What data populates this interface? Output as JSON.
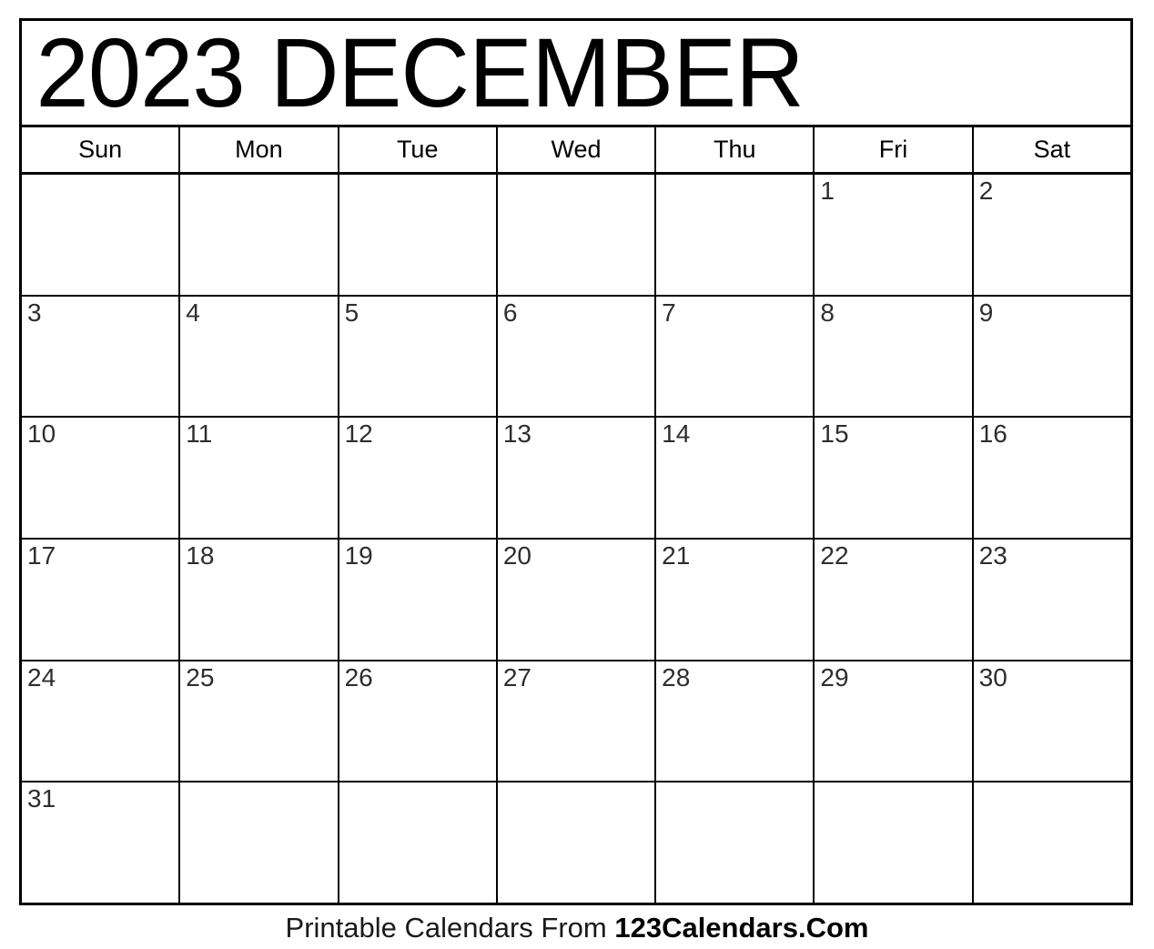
{
  "calendar": {
    "title": "2023 DECEMBER",
    "year": "2023",
    "month": "DECEMBER",
    "weekdays": [
      {
        "short": "Sun"
      },
      {
        "short": "Mon"
      },
      {
        "short": "Tue"
      },
      {
        "short": "Wed"
      },
      {
        "short": "Thu"
      },
      {
        "short": "Fri"
      },
      {
        "short": "Sat"
      }
    ],
    "weeks": [
      [
        {
          "day": ""
        },
        {
          "day": ""
        },
        {
          "day": ""
        },
        {
          "day": ""
        },
        {
          "day": ""
        },
        {
          "day": "1"
        },
        {
          "day": "2"
        }
      ],
      [
        {
          "day": "3"
        },
        {
          "day": "4"
        },
        {
          "day": "5"
        },
        {
          "day": "6"
        },
        {
          "day": "7"
        },
        {
          "day": "8"
        },
        {
          "day": "9"
        }
      ],
      [
        {
          "day": "10"
        },
        {
          "day": "11"
        },
        {
          "day": "12"
        },
        {
          "day": "13"
        },
        {
          "day": "14"
        },
        {
          "day": "15"
        },
        {
          "day": "16"
        }
      ],
      [
        {
          "day": "17"
        },
        {
          "day": "18"
        },
        {
          "day": "19"
        },
        {
          "day": "20"
        },
        {
          "day": "21"
        },
        {
          "day": "22"
        },
        {
          "day": "23"
        }
      ],
      [
        {
          "day": "24"
        },
        {
          "day": "25"
        },
        {
          "day": "26"
        },
        {
          "day": "27"
        },
        {
          "day": "28"
        },
        {
          "day": "29"
        },
        {
          "day": "30"
        }
      ],
      [
        {
          "day": "31"
        },
        {
          "day": ""
        },
        {
          "day": ""
        },
        {
          "day": ""
        },
        {
          "day": ""
        },
        {
          "day": ""
        },
        {
          "day": ""
        }
      ]
    ]
  },
  "footer": {
    "text": "Printable Calendars From ",
    "brand": "123Calendars.Com"
  },
  "colors": {
    "border": "#000000",
    "title_text": "#000000",
    "day_number_text": "#2e2e2e",
    "background": "#ffffff"
  }
}
